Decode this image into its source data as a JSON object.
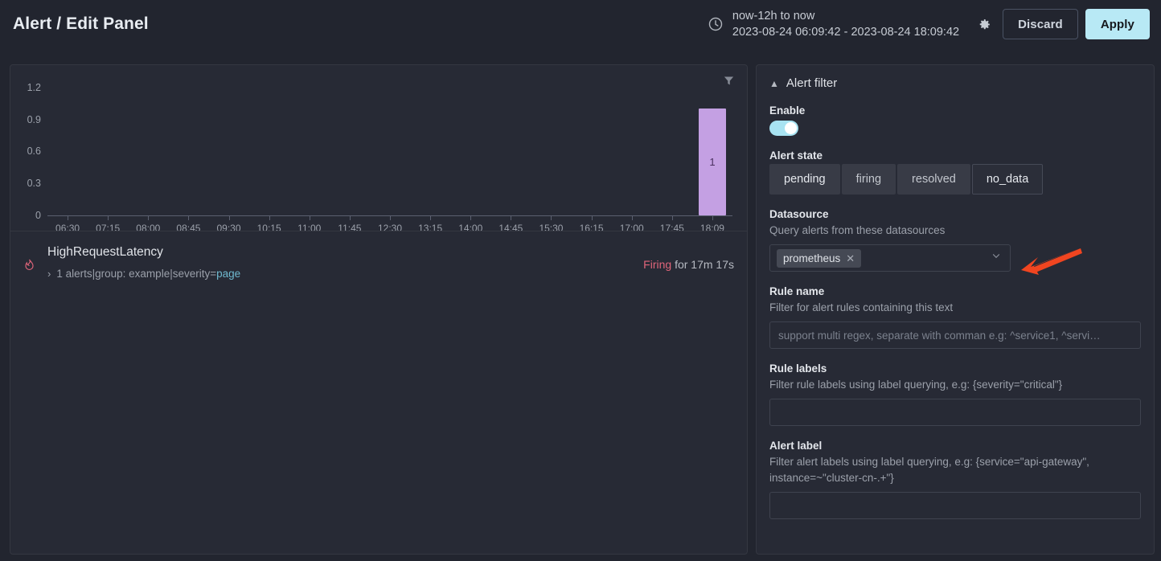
{
  "header": {
    "title": "Alert / Edit Panel",
    "clock_icon": "clock-icon",
    "time_relative": "now-12h to now",
    "time_absolute": "2023-08-24 06:09:42 - 2023-08-24 18:09:42",
    "gear_icon": "gear-icon",
    "discard_label": "Discard",
    "apply_label": "Apply"
  },
  "panel": {
    "filter_icon": "filter-icon",
    "chart": {
      "y_ticks": [
        "1.2",
        "0.9",
        "0.6",
        "0.3",
        "0"
      ],
      "x_ticks": [
        "06:30",
        "07:15",
        "08:00",
        "08:45",
        "09:30",
        "10:15",
        "11:00",
        "11:45",
        "12:30",
        "13:15",
        "14:00",
        "14:45",
        "15:30",
        "16:15",
        "17:00",
        "17:45",
        "18:09"
      ],
      "bar_label": "1"
    },
    "alert": {
      "flame_icon": "flame-icon",
      "name": "HighRequestLatency",
      "expand_icon": "chevron-right-icon",
      "meta_count": "1 alerts",
      "meta_group": "group: example",
      "meta_severity_key": "severity=",
      "meta_severity_value": "page",
      "separator": " | ",
      "state": "Firing",
      "duration": "for 17m 17s"
    }
  },
  "sidebar": {
    "collapse_icon": "chevron-up-icon",
    "section_title": "Alert filter",
    "enable": {
      "label": "Enable",
      "value": true
    },
    "alert_state": {
      "label": "Alert state",
      "options": [
        {
          "label": "pending",
          "selected": true
        },
        {
          "label": "firing",
          "selected": true
        },
        {
          "label": "resolved",
          "selected": true
        },
        {
          "label": "no_data",
          "selected": false
        }
      ]
    },
    "datasource": {
      "label": "Datasource",
      "description": "Query alerts from these datasources",
      "chips": [
        "prometheus"
      ],
      "remove_icon": "close-icon",
      "chevron_icon": "chevron-down-icon"
    },
    "rule_name": {
      "label": "Rule name",
      "description": "Filter for alert rules containing this text",
      "placeholder": "support multi regex, separate with comman e.g: ^service1, ^servi…",
      "value": ""
    },
    "rule_labels": {
      "label": "Rule labels",
      "description": "Filter rule labels using label querying, e.g: {severity=\"critical\"}",
      "placeholder": "",
      "value": ""
    },
    "alert_label": {
      "label": "Alert label",
      "description": "Filter alert labels using label querying, e.g: {service=\"api-gateway\", instance=~\"cluster-cn-.+\"}",
      "placeholder": "",
      "value": ""
    }
  },
  "annotation": {
    "arrow_icon": "arrow-pointer-icon",
    "color": "#f0452099"
  },
  "chart_data": {
    "type": "bar",
    "title": "",
    "xlabel": "",
    "ylabel": "",
    "categories": [
      "06:30",
      "07:15",
      "08:00",
      "08:45",
      "09:30",
      "10:15",
      "11:00",
      "11:45",
      "12:30",
      "13:15",
      "14:00",
      "14:45",
      "15:30",
      "16:15",
      "17:00",
      "17:45",
      "18:09"
    ],
    "values": [
      0,
      0,
      0,
      0,
      0,
      0,
      0,
      0,
      0,
      0,
      0,
      0,
      0,
      0,
      0,
      0,
      1
    ],
    "ylim": [
      0,
      1.35
    ],
    "yticks": [
      0,
      0.3,
      0.6,
      0.9,
      1.2
    ],
    "grid": false,
    "legend": false,
    "bar_color": "#c4a0e3",
    "data_labels": [
      "1"
    ]
  },
  "colors": {
    "accent": "#b8e9f5",
    "firing": "#e0657a",
    "bar": "#c4a0e3",
    "annotation": "#f04520",
    "panel_bg": "#272a35",
    "page_bg": "#22252f"
  }
}
